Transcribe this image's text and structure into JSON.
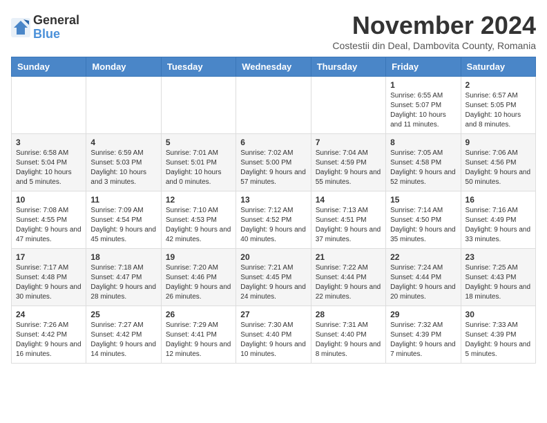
{
  "header": {
    "logo": {
      "general": "General",
      "blue": "Blue"
    },
    "title": "November 2024",
    "subtitle": "Costestii din Deal, Dambovita County, Romania"
  },
  "days_of_week": [
    "Sunday",
    "Monday",
    "Tuesday",
    "Wednesday",
    "Thursday",
    "Friday",
    "Saturday"
  ],
  "weeks": [
    [
      {
        "day": "",
        "info": ""
      },
      {
        "day": "",
        "info": ""
      },
      {
        "day": "",
        "info": ""
      },
      {
        "day": "",
        "info": ""
      },
      {
        "day": "",
        "info": ""
      },
      {
        "day": "1",
        "info": "Sunrise: 6:55 AM\nSunset: 5:07 PM\nDaylight: 10 hours and 11 minutes."
      },
      {
        "day": "2",
        "info": "Sunrise: 6:57 AM\nSunset: 5:05 PM\nDaylight: 10 hours and 8 minutes."
      }
    ],
    [
      {
        "day": "3",
        "info": "Sunrise: 6:58 AM\nSunset: 5:04 PM\nDaylight: 10 hours and 5 minutes."
      },
      {
        "day": "4",
        "info": "Sunrise: 6:59 AM\nSunset: 5:03 PM\nDaylight: 10 hours and 3 minutes."
      },
      {
        "day": "5",
        "info": "Sunrise: 7:01 AM\nSunset: 5:01 PM\nDaylight: 10 hours and 0 minutes."
      },
      {
        "day": "6",
        "info": "Sunrise: 7:02 AM\nSunset: 5:00 PM\nDaylight: 9 hours and 57 minutes."
      },
      {
        "day": "7",
        "info": "Sunrise: 7:04 AM\nSunset: 4:59 PM\nDaylight: 9 hours and 55 minutes."
      },
      {
        "day": "8",
        "info": "Sunrise: 7:05 AM\nSunset: 4:58 PM\nDaylight: 9 hours and 52 minutes."
      },
      {
        "day": "9",
        "info": "Sunrise: 7:06 AM\nSunset: 4:56 PM\nDaylight: 9 hours and 50 minutes."
      }
    ],
    [
      {
        "day": "10",
        "info": "Sunrise: 7:08 AM\nSunset: 4:55 PM\nDaylight: 9 hours and 47 minutes."
      },
      {
        "day": "11",
        "info": "Sunrise: 7:09 AM\nSunset: 4:54 PM\nDaylight: 9 hours and 45 minutes."
      },
      {
        "day": "12",
        "info": "Sunrise: 7:10 AM\nSunset: 4:53 PM\nDaylight: 9 hours and 42 minutes."
      },
      {
        "day": "13",
        "info": "Sunrise: 7:12 AM\nSunset: 4:52 PM\nDaylight: 9 hours and 40 minutes."
      },
      {
        "day": "14",
        "info": "Sunrise: 7:13 AM\nSunset: 4:51 PM\nDaylight: 9 hours and 37 minutes."
      },
      {
        "day": "15",
        "info": "Sunrise: 7:14 AM\nSunset: 4:50 PM\nDaylight: 9 hours and 35 minutes."
      },
      {
        "day": "16",
        "info": "Sunrise: 7:16 AM\nSunset: 4:49 PM\nDaylight: 9 hours and 33 minutes."
      }
    ],
    [
      {
        "day": "17",
        "info": "Sunrise: 7:17 AM\nSunset: 4:48 PM\nDaylight: 9 hours and 30 minutes."
      },
      {
        "day": "18",
        "info": "Sunrise: 7:18 AM\nSunset: 4:47 PM\nDaylight: 9 hours and 28 minutes."
      },
      {
        "day": "19",
        "info": "Sunrise: 7:20 AM\nSunset: 4:46 PM\nDaylight: 9 hours and 26 minutes."
      },
      {
        "day": "20",
        "info": "Sunrise: 7:21 AM\nSunset: 4:45 PM\nDaylight: 9 hours and 24 minutes."
      },
      {
        "day": "21",
        "info": "Sunrise: 7:22 AM\nSunset: 4:44 PM\nDaylight: 9 hours and 22 minutes."
      },
      {
        "day": "22",
        "info": "Sunrise: 7:24 AM\nSunset: 4:44 PM\nDaylight: 9 hours and 20 minutes."
      },
      {
        "day": "23",
        "info": "Sunrise: 7:25 AM\nSunset: 4:43 PM\nDaylight: 9 hours and 18 minutes."
      }
    ],
    [
      {
        "day": "24",
        "info": "Sunrise: 7:26 AM\nSunset: 4:42 PM\nDaylight: 9 hours and 16 minutes."
      },
      {
        "day": "25",
        "info": "Sunrise: 7:27 AM\nSunset: 4:42 PM\nDaylight: 9 hours and 14 minutes."
      },
      {
        "day": "26",
        "info": "Sunrise: 7:29 AM\nSunset: 4:41 PM\nDaylight: 9 hours and 12 minutes."
      },
      {
        "day": "27",
        "info": "Sunrise: 7:30 AM\nSunset: 4:40 PM\nDaylight: 9 hours and 10 minutes."
      },
      {
        "day": "28",
        "info": "Sunrise: 7:31 AM\nSunset: 4:40 PM\nDaylight: 9 hours and 8 minutes."
      },
      {
        "day": "29",
        "info": "Sunrise: 7:32 AM\nSunset: 4:39 PM\nDaylight: 9 hours and 7 minutes."
      },
      {
        "day": "30",
        "info": "Sunrise: 7:33 AM\nSunset: 4:39 PM\nDaylight: 9 hours and 5 minutes."
      }
    ]
  ]
}
